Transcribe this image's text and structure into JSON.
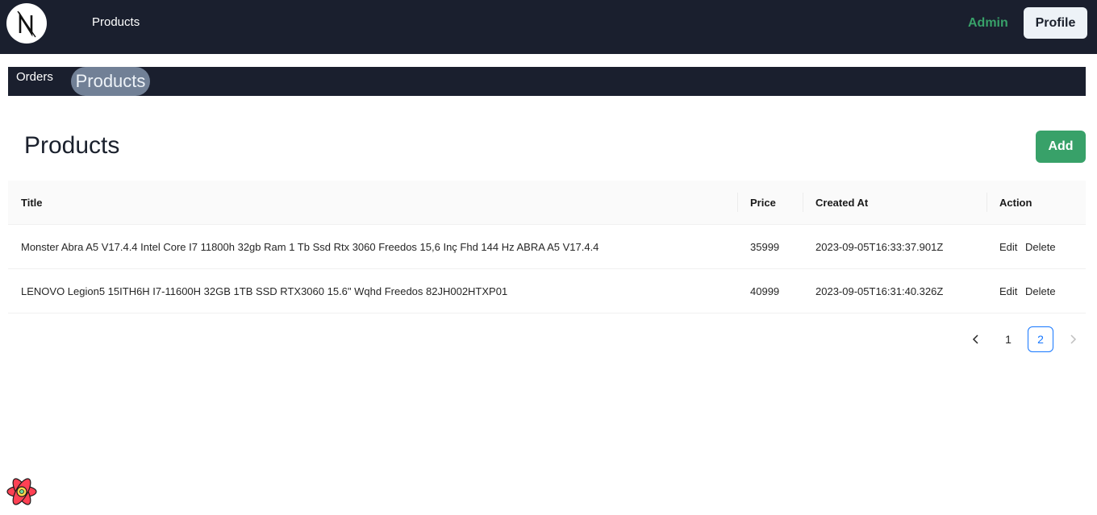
{
  "topbar": {
    "logo_letter": "N",
    "nav_link": "Products",
    "admin_label": "Admin",
    "profile_label": "Profile"
  },
  "subnav": {
    "items": [
      {
        "label": "Orders"
      },
      {
        "label": "Products"
      }
    ]
  },
  "page": {
    "title": "Products",
    "add_label": "Add"
  },
  "table": {
    "columns": [
      "Title",
      "Price",
      "Created At",
      "Action"
    ],
    "rows": [
      {
        "title": "Monster Abra A5 V17.4.4 Intel Core I7 11800h 32gb Ram 1 Tb Ssd Rtx 3060 Freedos 15,6 Inç Fhd 144 Hz ABRA A5 V17.4.4",
        "price": "35999",
        "created_at": "2023-09-05T16:33:37.901Z",
        "edit": "Edit",
        "delete": "Delete"
      },
      {
        "title": "LENOVO Legion5 15ITH6H I7-11600H 32GB 1TB SSD RTX3060 15.6\" Wqhd Freedos 82JH002HTXP01",
        "price": "40999",
        "created_at": "2023-09-05T16:31:40.326Z",
        "edit": "Edit",
        "delete": "Delete"
      }
    ]
  },
  "pagination": {
    "prev_icon": "chevron-left-icon",
    "next_icon": "chevron-right-icon",
    "pages": [
      "1",
      "2"
    ],
    "current": "2"
  },
  "colors": {
    "nav_bg": "#1a1f2e",
    "accent_green": "#38a169",
    "active_page": "#1677ff"
  }
}
